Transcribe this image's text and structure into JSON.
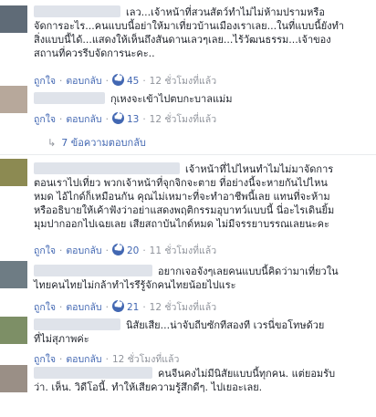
{
  "ui": {
    "like": "ถูกใจ",
    "reply": "ตอบกลับ",
    "time_ago": "12 ชั่วโมงที่แล้ว",
    "accent": "#4267b2"
  },
  "comments": [
    {
      "text_lines": [
        "เลว...เจ้าหน้าที่สวนสัตว์ทำไม่ไม่ห้ามปรามหรือ",
        "จัดการอะไร...คนแบบนี้อย่าให้มาเที่ยวบ้านเมืองเราเลย...ในที่แบบนี้ยังทำ",
        "สิ่งแบบนี้ได้...แสดงให้เห็นถึงสันดานเลวๆเลย...ไร้วัฒนธรรม...เจ้าของ",
        "สถานที่ควรรีบจัดการนะคะ.."
      ],
      "likes": "45",
      "time": "12 ชั่วโมงที่แล้ว"
    },
    {
      "text_lines": [
        "กุเหงจะเข้าไปตบกะบาลแม่ม"
      ],
      "likes": "13",
      "time": "12 ชั่วโมงที่แล้ว",
      "replies_label": "7 ข้อความตอบกลับ"
    },
    {
      "text_lines": [
        "เจ้าหน้าที่ไปไหนทำไมไม่มาจัดการ",
        "ตอนเราไปเที่ยว พวกเจ้าหน้าที่จุกจิกจะตาย ที่อย่างนี้จะหายกันไปไหน",
        "หมด ไอ้ไกด์ก็เหมือนกัน คุณไม่เหมาะที่จะทำอาชีพนี้เลย แทนที่จะห้าม",
        "หรืออธิบายให้เค้าฟังว่าอย่าแสดงพฤติกรรมอุบาทว์แบบนี้ นี่อะไรเดินยิ้ม",
        "มุมปากออกไปเฉยเลย เสียสถาบันไกด์หมด ไม่มีจรรยาบรรณเลยนะคะ"
      ],
      "likes": "20",
      "time": "11 ชั่วโมงที่แล้ว"
    },
    {
      "text_lines": [
        "อยากเจอจังๆเลยคนแบบนี้คิดว่ามาเที่ยวใน",
        "ไทยคนไทยไม่กล้าทำไรรึรู้จักคนไทยน้อยไปแระ"
      ],
      "likes": "21",
      "time": "12 ชั่วโมงที่แล้ว"
    },
    {
      "text_lines": [
        "นิสัยเสีย...น่าจับถีบซักทีสองที เวรนี่ขอโทษด้วย",
        "ที่ไม่สุภาพค่ะ"
      ],
      "likes": "",
      "time": "12 ชั่วโมงที่แล้ว"
    },
    {
      "text_lines": [
        "คนจีนคงไม่มีนิสัยแบบนี้ทุกคน. แต่ยอมรับ",
        "ว่า. เห็น. วิดีโอนี้. ทำให้เสียความรู้สึกดีๆ. ไปเยอะเลย."
      ],
      "likes": "",
      "time": ""
    }
  ]
}
